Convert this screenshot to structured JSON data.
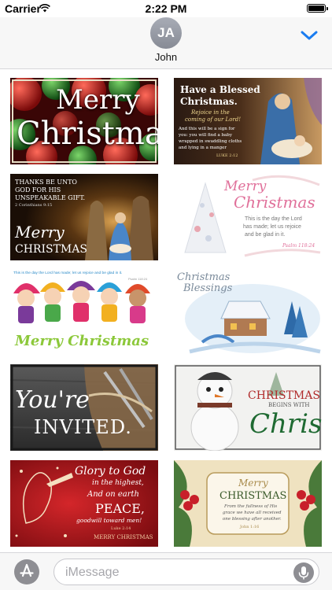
{
  "status_bar": {
    "carrier": "Carrier",
    "time": "2:22 PM",
    "battery_level": 1.0
  },
  "header": {
    "avatar_initials": "JA",
    "contact_name": "John",
    "icon": "chevron-down-icon"
  },
  "stickers": {
    "s1": {
      "line1": "Merry",
      "line2": "Christmas"
    },
    "s2": {
      "title1": "Have a Blessed",
      "title2": "Christmas.",
      "sub1": "Rejoice in the",
      "sub2": "coming of our Lord!",
      "body1": "And this will be a sign for",
      "body2": "you: you will find a baby",
      "body3": "wrapped in swaddling cloths",
      "body4": "and lying in a manger",
      "ref": "LUKE 2:12"
    },
    "s3": {
      "top1": "THANKS BE UNTO",
      "top2": "GOD FOR HIS",
      "top3": "UNSPEAKABLE GIFT.",
      "ref": "2 Corinthians 9:15",
      "line1": "Merry",
      "line2": "CHRISTMAS"
    },
    "s4": {
      "line1": "Merry",
      "line2": "Christmas",
      "body1": "This is the day the Lord",
      "body2": "has made; let us rejoice",
      "body3": "and be glad in it.",
      "ref": "Psalm 118:24"
    },
    "s5": {
      "top": "This is the day the Lord has made; let us rejoice and be glad in it.",
      "ref": "Psalm 118:24",
      "line": "Merry Christmas"
    },
    "s6": {
      "line1": "Christmas",
      "line2": "Blessings"
    },
    "s7": {
      "line1": "You're",
      "line2": "INVITED."
    },
    "s8": {
      "line1": "CHRISTMAS",
      "line2": "BEGINS WITH",
      "line3": "Christ"
    },
    "s9": {
      "l1": "Glory to God",
      "l2": "in the highest,",
      "l3": "And on earth",
      "l4": "PEACE,",
      "l5": "goodwill toward men!",
      "ref": "Luke 2:14",
      "l6": "MERRY CHRISTMAS"
    },
    "s10": {
      "l1": "Merry",
      "l2": "CHRISTMAS",
      "l3": "From the fullness of His",
      "l4": "grace we have all received",
      "l5": "one blessing after another.",
      "ref": "John 1:16"
    }
  },
  "compose": {
    "placeholder": "iMessage",
    "apps_icon": "app-store-icon",
    "mic_icon": "microphone-icon"
  }
}
